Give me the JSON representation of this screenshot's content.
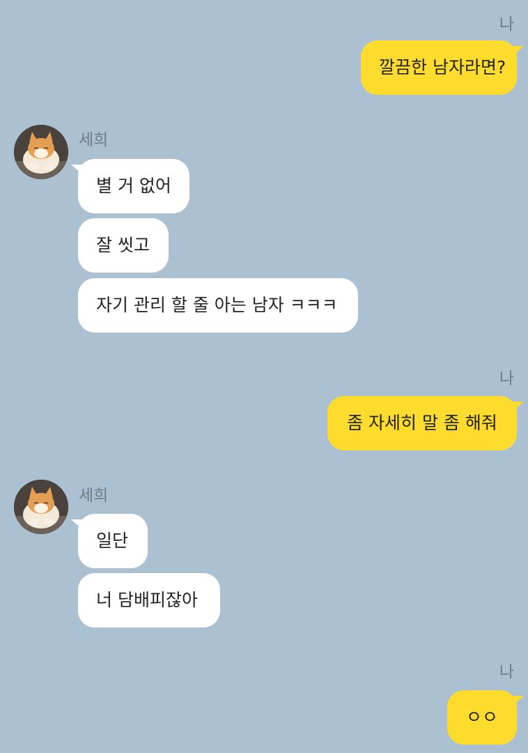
{
  "me_name": "나",
  "other_name": "세희",
  "messages": [
    {
      "from": "me",
      "text": "깔끔한 남자라면?"
    },
    {
      "from": "other",
      "text": "별 거 없어"
    },
    {
      "from": "other",
      "text": "잘 씻고"
    },
    {
      "from": "other",
      "text": "자기 관리 할 줄 아는 남자 ㅋㅋㅋ"
    },
    {
      "from": "me",
      "text": "좀 자세히 말 좀 해줘"
    },
    {
      "from": "other",
      "text": "일단"
    },
    {
      "from": "other",
      "text": "너 담배피잖아"
    },
    {
      "from": "me",
      "text": "ㅇㅇ"
    }
  ],
  "colors": {
    "background": "#abc1d1",
    "my_bubble": "#fedc2e",
    "their_bubble": "#ffffff"
  },
  "icons": {
    "avatar": "cat-avatar-icon"
  }
}
